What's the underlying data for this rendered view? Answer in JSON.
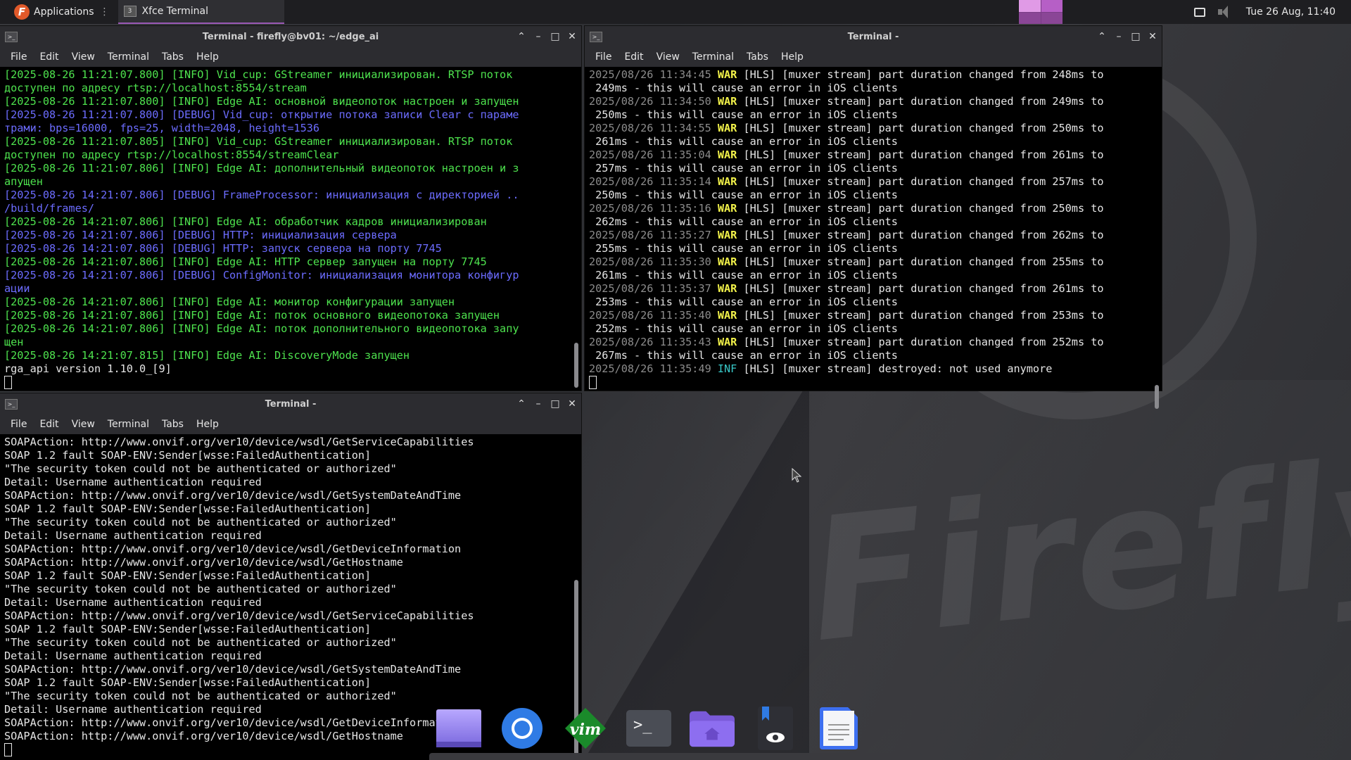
{
  "panel": {
    "applications_label": "Applications",
    "task_label": "Xfce Terminal",
    "clock": "Tue 26 Aug, 11:40"
  },
  "menu": [
    "File",
    "Edit",
    "View",
    "Terminal",
    "Tabs",
    "Help"
  ],
  "win1": {
    "title": "Terminal - firefly@bv01: ~/edge_ai",
    "lines": [
      {
        "c": "green",
        "t": "[2025-08-26 11:21:07.800] [INFO] Vid_cup: GStreamer инициализирован. RTSP поток"
      },
      {
        "c": "green",
        "t": "доступен по адресу rtsp://localhost:8554/stream"
      },
      {
        "c": "green",
        "t": "[2025-08-26 11:21:07.800] [INFO] Edge AI: основной видеопоток настроен и запущен"
      },
      {
        "c": "blue",
        "t": "[2025-08-26 11:21:07.800] [DEBUG] Vid_cup: открытие потока записи Clear с параме"
      },
      {
        "c": "blue",
        "t": "трами: bps=16000, fps=25, width=2048, height=1536"
      },
      {
        "c": "green",
        "t": "[2025-08-26 11:21:07.805] [INFO] Vid_cup: GStreamer инициализирован. RTSP поток"
      },
      {
        "c": "green",
        "t": "доступен по адресу rtsp://localhost:8554/streamClear"
      },
      {
        "c": "green",
        "t": "[2025-08-26 11:21:07.806] [INFO] Edge AI: дополнительный видеопоток настроен и з"
      },
      {
        "c": "green",
        "t": "апущен"
      },
      {
        "c": "blue",
        "t": "[2025-08-26 14:21:07.806] [DEBUG] FrameProcessor: инициализация с директорией .."
      },
      {
        "c": "blue",
        "t": "/build/frames/"
      },
      {
        "c": "green",
        "t": "[2025-08-26 14:21:07.806] [INFO] Edge AI: обработчик кадров инициализирован"
      },
      {
        "c": "blue",
        "t": "[2025-08-26 14:21:07.806] [DEBUG] HTTP: инициализация сервера"
      },
      {
        "c": "blue",
        "t": "[2025-08-26 14:21:07.806] [DEBUG] HTTP: запуск сервера на порту 7745"
      },
      {
        "c": "green",
        "t": "[2025-08-26 14:21:07.806] [INFO] Edge AI: HTTP сервер запущен на порту 7745"
      },
      {
        "c": "blue",
        "t": "[2025-08-26 14:21:07.806] [DEBUG] ConfigMonitor: инициализация монитора конфигур"
      },
      {
        "c": "blue",
        "t": "ации"
      },
      {
        "c": "green",
        "t": "[2025-08-26 14:21:07.806] [INFO] Edge AI: монитор конфигурации запущен"
      },
      {
        "c": "green",
        "t": "[2025-08-26 14:21:07.806] [INFO] Edge AI: поток основного видеопотока запущен"
      },
      {
        "c": "green",
        "t": "[2025-08-26 14:21:07.806] [INFO] Edge AI: поток дополнительного видеопотока запу"
      },
      {
        "c": "green",
        "t": "щен"
      },
      {
        "c": "green",
        "t": "[2025-08-26 14:21:07.815] [INFO] Edge AI: DiscoveryMode запущен"
      },
      {
        "c": "white",
        "t": "rga_api version 1.10.0_[9]"
      }
    ]
  },
  "win2": {
    "title": "Terminal -",
    "entries": [
      {
        "ts": "2025/08/26 11:34:45",
        "lvl": "WAR",
        "msg": " [HLS] [muxer stream] part duration changed from 248ms to",
        "cont": " 249ms - this will cause an error in iOS clients"
      },
      {
        "ts": "2025/08/26 11:34:50",
        "lvl": "WAR",
        "msg": " [HLS] [muxer stream] part duration changed from 249ms to",
        "cont": " 250ms - this will cause an error in iOS clients"
      },
      {
        "ts": "2025/08/26 11:34:55",
        "lvl": "WAR",
        "msg": " [HLS] [muxer stream] part duration changed from 250ms to",
        "cont": " 261ms - this will cause an error in iOS clients"
      },
      {
        "ts": "2025/08/26 11:35:04",
        "lvl": "WAR",
        "msg": " [HLS] [muxer stream] part duration changed from 261ms to",
        "cont": " 257ms - this will cause an error in iOS clients"
      },
      {
        "ts": "2025/08/26 11:35:14",
        "lvl": "WAR",
        "msg": " [HLS] [muxer stream] part duration changed from 257ms to",
        "cont": " 250ms - this will cause an error in iOS clients"
      },
      {
        "ts": "2025/08/26 11:35:16",
        "lvl": "WAR",
        "msg": " [HLS] [muxer stream] part duration changed from 250ms to",
        "cont": " 262ms - this will cause an error in iOS clients"
      },
      {
        "ts": "2025/08/26 11:35:27",
        "lvl": "WAR",
        "msg": " [HLS] [muxer stream] part duration changed from 262ms to",
        "cont": " 255ms - this will cause an error in iOS clients"
      },
      {
        "ts": "2025/08/26 11:35:30",
        "lvl": "WAR",
        "msg": " [HLS] [muxer stream] part duration changed from 255ms to",
        "cont": " 261ms - this will cause an error in iOS clients"
      },
      {
        "ts": "2025/08/26 11:35:37",
        "lvl": "WAR",
        "msg": " [HLS] [muxer stream] part duration changed from 261ms to",
        "cont": " 253ms - this will cause an error in iOS clients"
      },
      {
        "ts": "2025/08/26 11:35:40",
        "lvl": "WAR",
        "msg": " [HLS] [muxer stream] part duration changed from 253ms to",
        "cont": " 252ms - this will cause an error in iOS clients"
      },
      {
        "ts": "2025/08/26 11:35:43",
        "lvl": "WAR",
        "msg": " [HLS] [muxer stream] part duration changed from 252ms to",
        "cont": " 267ms - this will cause an error in iOS clients"
      },
      {
        "ts": "2025/08/26 11:35:49",
        "lvl": "INF",
        "msg": " [HLS] [muxer stream] destroyed: not used anymore",
        "cont": ""
      }
    ]
  },
  "win3": {
    "title": "Terminal -",
    "lines": [
      "SOAPAction: http://www.onvif.org/ver10/device/wsdl/GetServiceCapabilities",
      "SOAP 1.2 fault SOAP-ENV:Sender[wsse:FailedAuthentication]",
      "\"The security token could not be authenticated or authorized\"",
      "Detail: Username authentication required",
      "SOAPAction: http://www.onvif.org/ver10/device/wsdl/GetSystemDateAndTime",
      "SOAP 1.2 fault SOAP-ENV:Sender[wsse:FailedAuthentication]",
      "\"The security token could not be authenticated or authorized\"",
      "Detail: Username authentication required",
      "SOAPAction: http://www.onvif.org/ver10/device/wsdl/GetDeviceInformation",
      "SOAPAction: http://www.onvif.org/ver10/device/wsdl/GetHostname",
      "SOAP 1.2 fault SOAP-ENV:Sender[wsse:FailedAuthentication]",
      "\"The security token could not be authenticated or authorized\"",
      "Detail: Username authentication required",
      "SOAPAction: http://www.onvif.org/ver10/device/wsdl/GetServiceCapabilities",
      "SOAP 1.2 fault SOAP-ENV:Sender[wsse:FailedAuthentication]",
      "\"The security token could not be authenticated or authorized\"",
      "Detail: Username authentication required",
      "SOAPAction: http://www.onvif.org/ver10/device/wsdl/GetSystemDateAndTime",
      "SOAP 1.2 fault SOAP-ENV:Sender[wsse:FailedAuthentication]",
      "\"The security token could not be authenticated or authorized\"",
      "Detail: Username authentication required",
      "SOAPAction: http://www.onvif.org/ver10/device/wsdl/GetDeviceInformation",
      "SOAPAction: http://www.onvif.org/ver10/device/wsdl/GetHostname"
    ]
  },
  "wallpaper": {
    "logo_text": "Firefly"
  },
  "dock": [
    {
      "name": "desktop-icon"
    },
    {
      "name": "chromium-icon"
    },
    {
      "name": "vim-icon",
      "label": "vim"
    },
    {
      "name": "terminal-icon",
      "label": ">_"
    },
    {
      "name": "home-folder-icon"
    },
    {
      "name": "document-viewer-icon"
    },
    {
      "name": "text-editor-icon"
    }
  ],
  "colors": {
    "accent": "#9b59b6",
    "info": "#4ee34e",
    "debug": "#6c6cff",
    "warn": "#f2f24a",
    "inf": "#38c8c8"
  }
}
